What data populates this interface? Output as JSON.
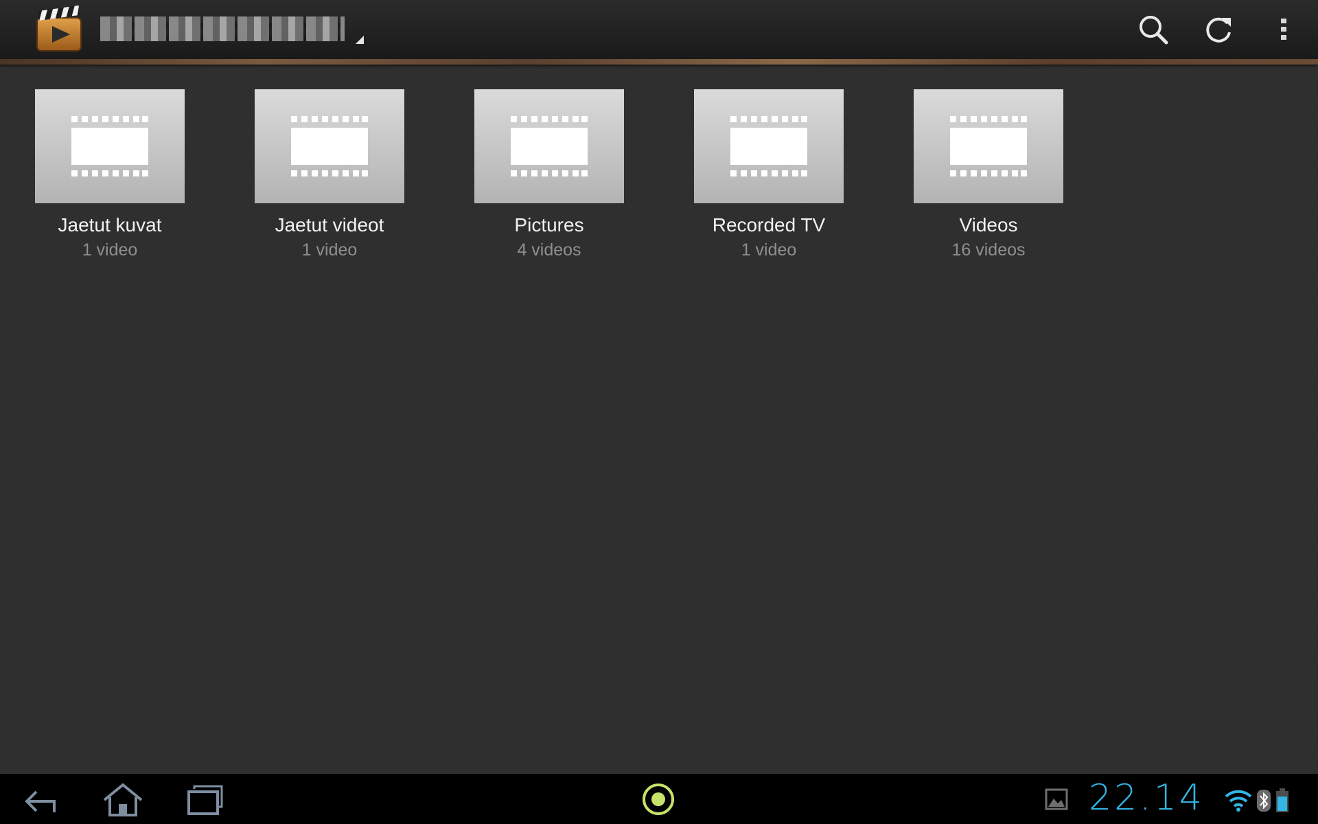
{
  "action_bar": {
    "title": "",
    "icons": [
      "video-player-app-icon",
      "search-icon",
      "refresh-icon",
      "overflow-menu-icon"
    ]
  },
  "folders": [
    {
      "name": "Jaetut kuvat",
      "count": "1 video"
    },
    {
      "name": "Jaetut videot",
      "count": "1 video"
    },
    {
      "name": "Pictures",
      "count": "4 videos"
    },
    {
      "name": "Recorded TV",
      "count": "1 video"
    },
    {
      "name": "Videos",
      "count": "16 videos"
    }
  ],
  "system_bar": {
    "clock": "22.14",
    "icons": [
      "back-icon",
      "home-icon",
      "recent-apps-icon",
      "app-indicator-icon",
      "image-notification-icon",
      "wifi-icon",
      "bluetooth-icon",
      "battery-icon"
    ]
  },
  "colors": {
    "background": "#2e2e2e",
    "action_bar": "#1f1f1f",
    "clock": "#33b5e5",
    "indicator": "#c6e36a",
    "secondary_text": "#8f8f8f"
  }
}
